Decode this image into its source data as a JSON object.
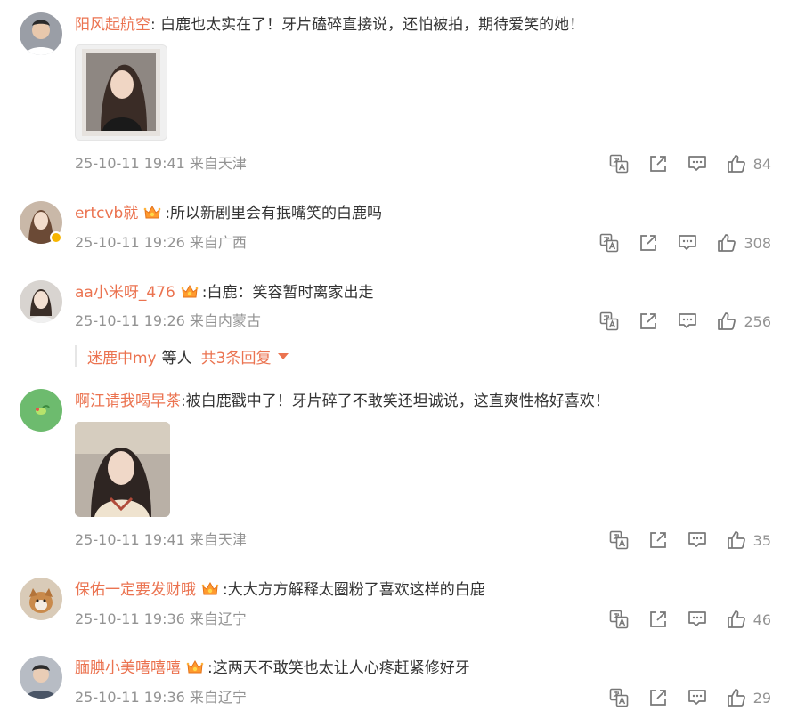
{
  "comments": [
    {
      "user": "阳风起航空",
      "text": ": 白鹿也太实在了！牙片磕碎直接说，还怕被拍，期待爱笑的她！",
      "time": "25-10-11 19:41",
      "location": "来自天津",
      "likes": "84",
      "has_image": true
    },
    {
      "user": "ertcvb就",
      "text": ":所以新剧里会有抿嘴笑的白鹿吗",
      "time": "25-10-11 19:26",
      "location": "来自广西",
      "likes": "308",
      "verified": true
    },
    {
      "user": "aa小米呀_476",
      "text": ":白鹿：笑容暂时离家出走",
      "time": "25-10-11 19:26",
      "location": "来自内蒙古",
      "likes": "256",
      "replies": {
        "user": "迷鹿中my",
        "suffix": "等人",
        "count_label": "共3条回复"
      }
    },
    {
      "user": "啊江请我喝早茶",
      "text": ":被白鹿戳中了！牙片碎了不敢笑还坦诚说，这直爽性格好喜欢！",
      "time": "25-10-11 19:41",
      "location": "来自天津",
      "likes": "35",
      "has_image": true
    },
    {
      "user": "保佑一定要发财哦",
      "text": ":大大方方解释太圈粉了喜欢这样的白鹿",
      "time": "25-10-11 19:36",
      "location": "来自辽宁",
      "likes": "46"
    },
    {
      "user": "腼腆小美嘻嘻嘻",
      "text": ":这两天不敢笑也太让人心疼赶紧修好牙",
      "time": "25-10-11 19:36",
      "location": "来自辽宁",
      "likes": "29"
    }
  ],
  "icons": [
    "translate-icon",
    "share-icon",
    "comment-icon",
    "like-icon",
    "crown-badge-icon"
  ],
  "colors": {
    "username": "#eb7350",
    "meta": "#939393",
    "text": "#333333"
  }
}
